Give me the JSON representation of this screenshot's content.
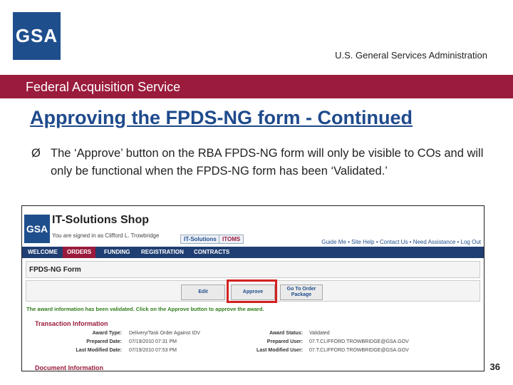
{
  "header": {
    "logo_text": "GSA",
    "agency_name": "U.S. General Services Administration",
    "service_bar": "Federal Acquisition Service"
  },
  "slide": {
    "title": "Approving the FPDS-NG form - Continued",
    "bullet_marker": "Ø",
    "bullet_text": "The ‘Approve’ button on the RBA FPDS-NG form will only be visible to COs and will only be functional when the FPDS-NG form has been ‘Validated.’",
    "page_number": "36"
  },
  "screenshot": {
    "logo_text": "GSA",
    "app_title": "IT-Solutions Shop",
    "signed_in": "You are signed in as Clifford L. Trowbridge",
    "tab_its": "IT-Solutions",
    "tab_itoms": "ITOMS",
    "top_links": "Guide Me • Site Help • Contact Us • Need Assistance  •  Log Out",
    "menu": [
      "WELCOME",
      "ORDERS",
      "FUNDING",
      "REGISTRATION",
      "CONTRACTS"
    ],
    "active_menu": "ORDERS",
    "form_title": "FPDS-NG Form",
    "buttons": {
      "edit": "Edit",
      "approve": "Approve",
      "go_to_order_package": "Go To Order Package"
    },
    "validation_message": "The award information has been validated. Click on the Approve button to approve the award.",
    "transaction_section": "Transaction Information",
    "fields_left": [
      {
        "label": "Award Type:",
        "value": "Delivery/Task Order Against IDV"
      },
      {
        "label": "Prepared Date:",
        "value": "07/19/2010 07:31 PM"
      },
      {
        "label": "Last Modified Date:",
        "value": "07/19/2010 07:53 PM"
      }
    ],
    "fields_right": [
      {
        "label": "Award Status:",
        "value": "Validated"
      },
      {
        "label": "Prepared User:",
        "value": "07.T.CLIFFORD.TROWBRIDGE@GSA.GOV"
      },
      {
        "label": "Last Modified User:",
        "value": "07.T.CLIFFORD.TROWBRIDGE@GSA.GOV"
      }
    ],
    "document_section": "Document Information"
  },
  "colors": {
    "brand_blue": "#1f4e8c",
    "service_bar": "#9a1b3c",
    "highlight": "#d42020"
  }
}
